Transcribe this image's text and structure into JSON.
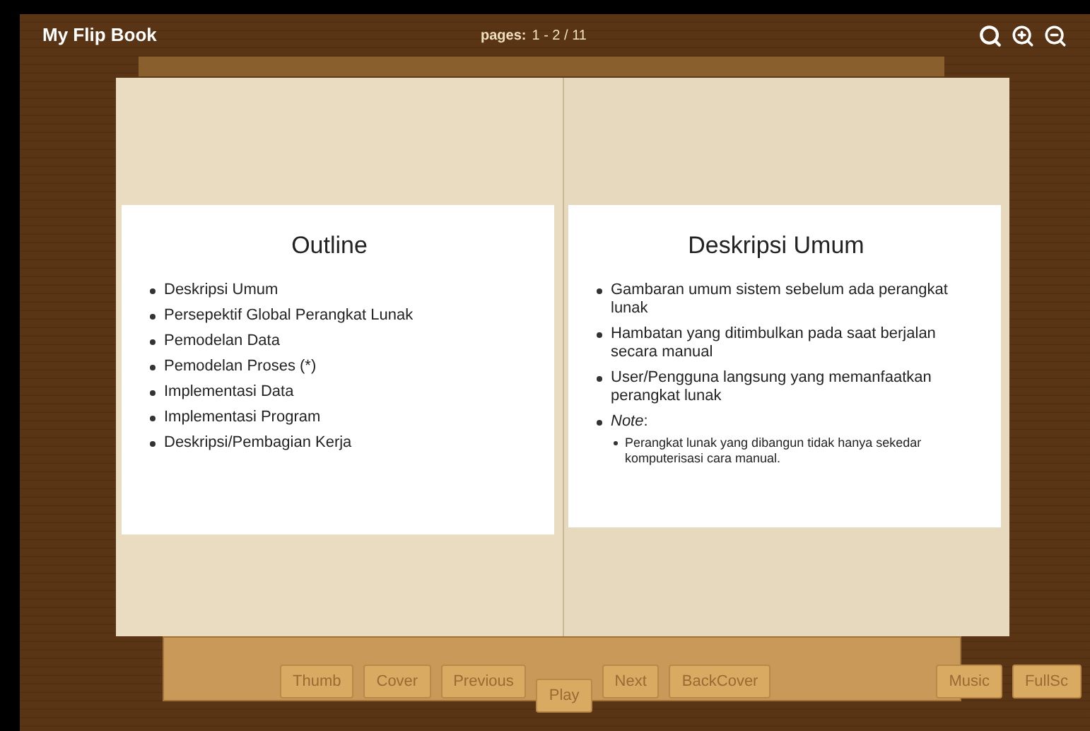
{
  "header": {
    "title": "My Flip Book",
    "pages_label": "pages:",
    "pages_value": "1 - 2 / 11"
  },
  "left_page": {
    "heading": "Outline",
    "bullets": [
      {
        "text": "Deskripsi Umum"
      },
      {
        "text": "Persepektif Global Perangkat Lunak"
      },
      {
        "text": "Pemodelan Data"
      },
      {
        "text": "Pemodelan Proses (*)"
      },
      {
        "text": "Implementasi Data"
      },
      {
        "text": "Implementasi Program"
      },
      {
        "text": "Deskripsi/Pembagian Kerja"
      }
    ]
  },
  "right_page": {
    "heading": "Deskripsi Umum",
    "bullets": [
      {
        "text": "Gambaran umum sistem sebelum ada perangkat lunak"
      },
      {
        "text": "Hambatan yang ditimbulkan pada saat berjalan secara manual"
      },
      {
        "text": "User/Pengguna langsung yang memanfaatkan perangkat lunak"
      },
      {
        "text": "*Note*:",
        "children": [
          {
            "text": "Perangkat lunak yang dibangun tidak hanya sekedar komputerisasi cara manual."
          }
        ]
      }
    ]
  },
  "nav_buttons": [
    "Thumb",
    "Cover",
    "Previous",
    "Play",
    "Next",
    "BackCover"
  ],
  "side_buttons": [
    "Music",
    "FullSc"
  ]
}
